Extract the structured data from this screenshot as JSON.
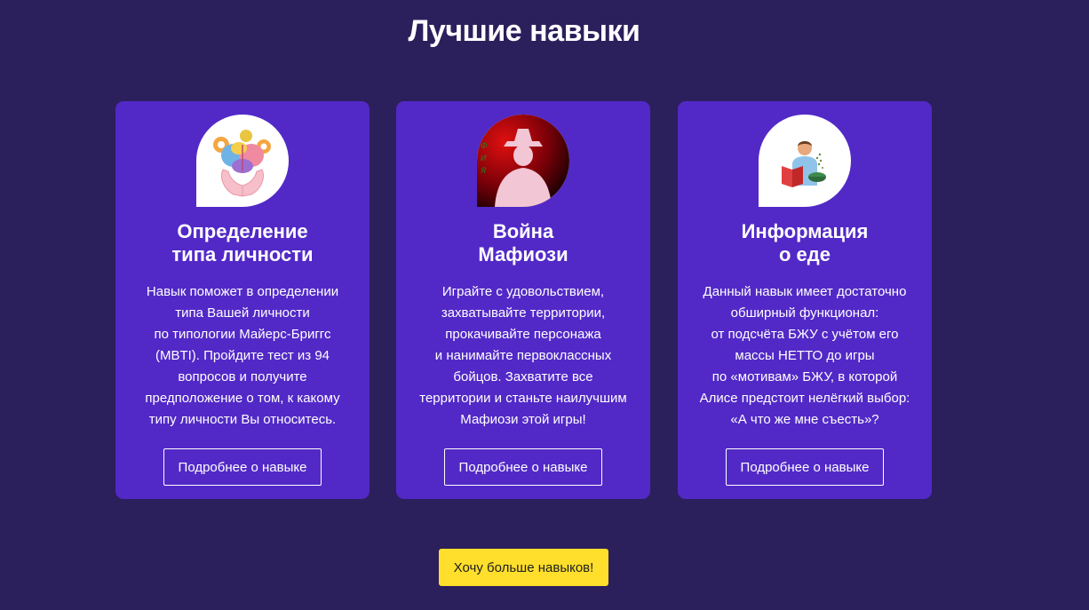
{
  "page": {
    "title": "Лучшие навыки",
    "more_button_label": "Хочу больше навыков!"
  },
  "colors": {
    "background": "#2b1f5c",
    "card": "#5229c7",
    "accent_button": "#ffdf2b"
  },
  "cards": [
    {
      "image": "brain-in-hands-icon",
      "title_lines": [
        "Определение",
        "типа личности"
      ],
      "description_lines": [
        "Навык поможет в определении",
        "типа Вашей личности",
        "по типологии Майерс-Бриггс",
        "(MBTI). Пройдите тест из 94",
        "вопросов и получите",
        "предположение о том, к какому",
        "типу личности Вы относитесь."
      ],
      "button_label": "Подробнее о навыке"
    },
    {
      "image": "mafia-gangster-icon",
      "image_text": "МАФИЯ",
      "title_lines": [
        "Война",
        "Мафиози"
      ],
      "description_lines": [
        "Играйте с удовольствием,",
        "захватывайте территории,",
        "прокачивайте персонажа",
        "и нанимайте первоклассных",
        "бойцов. Захватите все",
        "территории и станьте наилучшим",
        "Мафиози этой игры!"
      ],
      "button_label": "Подробнее о навыке"
    },
    {
      "image": "man-reading-food-icon",
      "title_lines": [
        "Информация",
        "о еде"
      ],
      "description_lines": [
        "Данный навык имеет достаточно",
        "обширный функционал:",
        "от подсчёта БЖУ с учётом его",
        "массы НЕТТО до игры",
        "по «мотивам» БЖУ, в которой",
        "Алисе предстоит нелёгкий выбор:",
        "«А что же мне съесть»?"
      ],
      "button_label": "Подробнее о навыке"
    }
  ]
}
